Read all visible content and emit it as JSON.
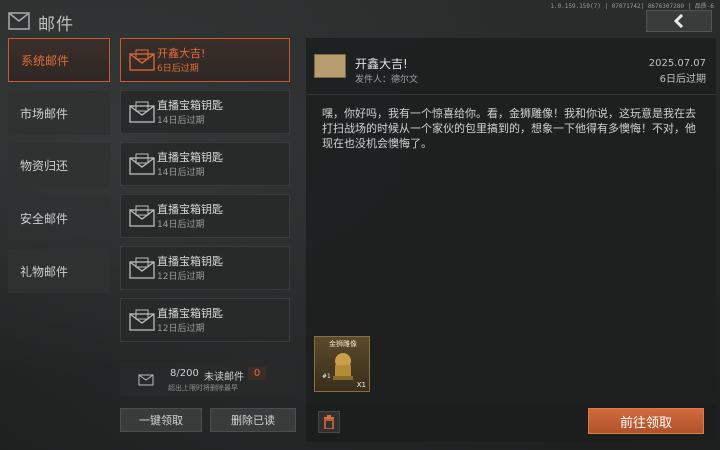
{
  "header": {
    "title": "邮件",
    "build_info": "1.0.159.159(7) | 07071742| 8676307280 | 品质-6",
    "back_icon": "chevron-left-icon"
  },
  "categories": [
    {
      "label": "系统邮件",
      "active": true
    },
    {
      "label": "市场邮件",
      "active": false
    },
    {
      "label": "物资归还",
      "active": false
    },
    {
      "label": "安全邮件",
      "active": false
    },
    {
      "label": "礼物邮件",
      "active": false
    }
  ],
  "mail_list": [
    {
      "title": "开鑫大吉!",
      "subtitle": "6日后过期",
      "active": true
    },
    {
      "title": "直播宝箱钥匙",
      "subtitle": "14日后过期",
      "active": false
    },
    {
      "title": "直播宝箱钥匙",
      "subtitle": "14日后过期",
      "active": false
    },
    {
      "title": "直播宝箱钥匙",
      "subtitle": "14日后过期",
      "active": false
    },
    {
      "title": "直播宝箱钥匙",
      "subtitle": "12日后过期",
      "active": false
    },
    {
      "title": "直播宝箱钥匙",
      "subtitle": "12日后过期",
      "active": false
    }
  ],
  "mail_count": {
    "count": "8/200",
    "unread_label": "未读邮件",
    "unread": "0",
    "note": "超出上限时将删除最早"
  },
  "actions": {
    "claim_all": "一键领取",
    "delete_read": "删除已读"
  },
  "detail": {
    "title": "开鑫大吉!",
    "sender": "发件人：德尔文",
    "date": "2025.07.07",
    "expire": "6日后过期",
    "body": "嘿，你好吗，我有一个惊喜给你。看，金狮雕像！我和你说，这玩意是我在去打扫战场的时候从一个家伙的包里搞到的，想象一下他得有多懊悔！不对，他现在也没机会懊悔了。",
    "attachment": {
      "name": "金狮雕像",
      "qty": "X1",
      "tag": "#1"
    },
    "goto_label": "前往领取"
  },
  "colors": {
    "accent": "#d26a3d",
    "active_text": "#e06b3a",
    "bg": "#1f2121"
  }
}
